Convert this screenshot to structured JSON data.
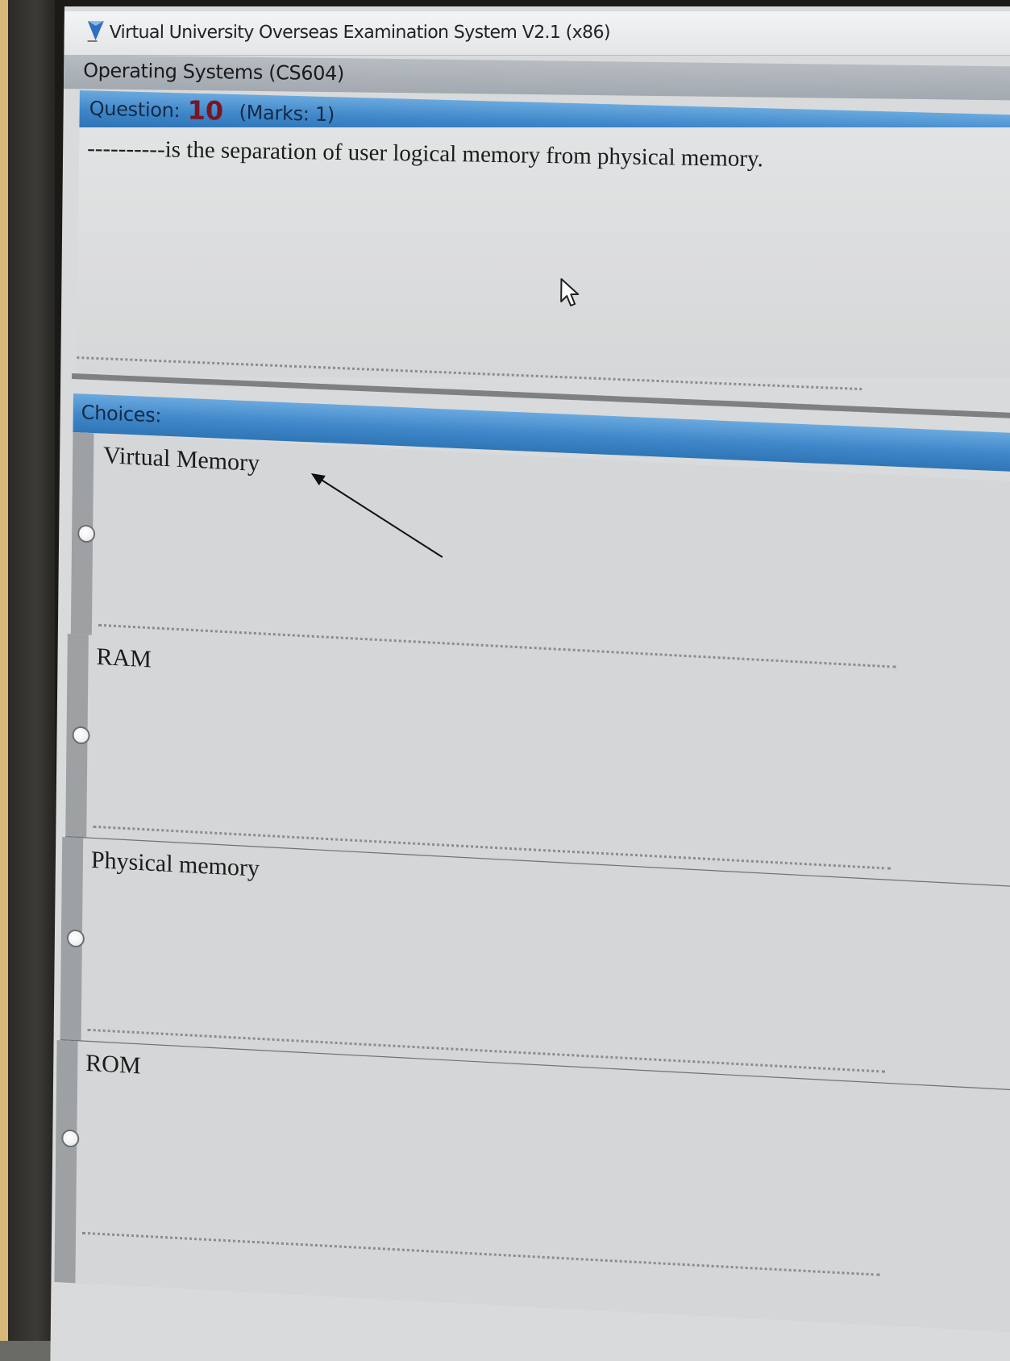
{
  "window": {
    "title": "Virtual University Overseas Examination System  V2.1 (x86)",
    "icon": "app-logo-icon"
  },
  "course": {
    "title": "Operating Systems  (CS604)"
  },
  "question": {
    "label": "Question:",
    "number": "10",
    "marks": "(Marks: 1)",
    "text": "----------is the separation of user logical memory from physical memory."
  },
  "choices": {
    "label": "Choices:",
    "items": [
      {
        "label": "Virtual Memory"
      },
      {
        "label": "RAM"
      },
      {
        "label": "Physical memory"
      },
      {
        "label": "ROM"
      }
    ]
  },
  "colors": {
    "header_blue": "#3d86c9",
    "question_number": "#7a1520",
    "panel": "#d9dadb"
  }
}
